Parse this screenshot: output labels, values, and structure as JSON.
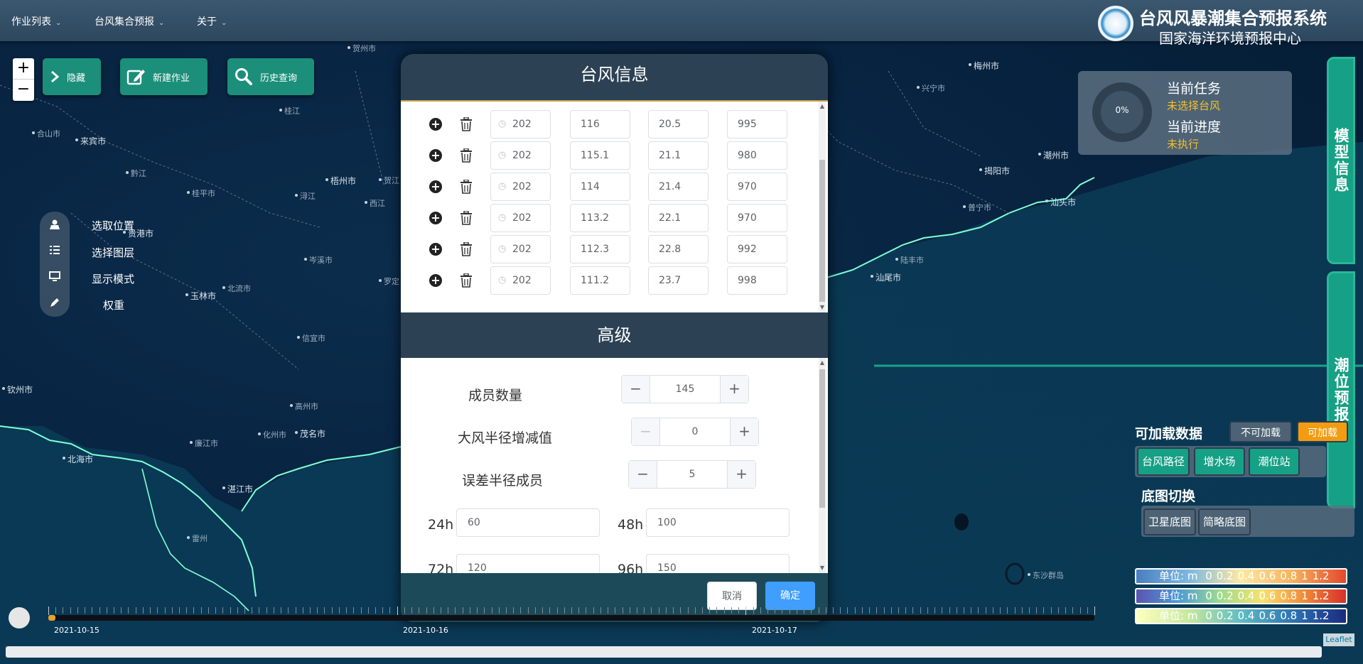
{
  "menu": {
    "items": [
      {
        "label": "作业列表"
      },
      {
        "label": "台风集合预报"
      },
      {
        "label": "关于"
      }
    ]
  },
  "header": {
    "title": "台风风暴潮集合预报系统",
    "subtitle": "国家海洋环境预报中心"
  },
  "zoom": {
    "in": "+",
    "out": "−"
  },
  "actions": {
    "hide": "隐藏",
    "new_job": "新建作业",
    "history": "历史查询"
  },
  "tools": [
    {
      "label": "选取位置",
      "icon": "map-marker-icon"
    },
    {
      "label": "选择图层",
      "icon": "list-icon"
    },
    {
      "label": "显示模式",
      "icon": "monitor-icon"
    },
    {
      "label": "权重",
      "icon": "pen-icon"
    }
  ],
  "map_labels": [
    {
      "name": "贺州市"
    },
    {
      "name": "合山市"
    },
    {
      "name": "来宾市"
    },
    {
      "name": "桂江"
    },
    {
      "name": "黔江"
    },
    {
      "name": "梧州市"
    },
    {
      "name": "贺江"
    },
    {
      "name": "西江"
    },
    {
      "name": "桂平市"
    },
    {
      "name": "浔江"
    },
    {
      "name": "贵港市"
    },
    {
      "name": "岑溪市"
    },
    {
      "name": "罗定"
    },
    {
      "name": "玉林市"
    },
    {
      "name": "北流市"
    },
    {
      "name": "信宜市"
    },
    {
      "name": "钦州市"
    },
    {
      "name": "高州市"
    },
    {
      "name": "化州市"
    },
    {
      "name": "茂名市"
    },
    {
      "name": "北海市"
    },
    {
      "name": "廉江市"
    },
    {
      "name": "湛江市"
    },
    {
      "name": "雷州"
    },
    {
      "name": "梅州市"
    },
    {
      "name": "兴宁市"
    },
    {
      "name": "揭阳市"
    },
    {
      "name": "潮州市"
    },
    {
      "name": "普宁市"
    },
    {
      "name": "汕头市"
    },
    {
      "name": "陆丰市"
    },
    {
      "name": "汕尾市"
    },
    {
      "name": "东沙群岛"
    }
  ],
  "modal": {
    "title": "台风信息",
    "track_rows": [
      {
        "time": "202",
        "lon": "116",
        "lat": "20.5",
        "pressure": "995"
      },
      {
        "time": "202",
        "lon": "115.1",
        "lat": "21.1",
        "pressure": "980"
      },
      {
        "time": "202",
        "lon": "114",
        "lat": "21.4",
        "pressure": "970"
      },
      {
        "time": "202",
        "lon": "113.2",
        "lat": "22.1",
        "pressure": "970"
      },
      {
        "time": "202",
        "lon": "112.3",
        "lat": "22.8",
        "pressure": "992"
      },
      {
        "time": "202",
        "lon": "111.2",
        "lat": "23.7",
        "pressure": "998"
      }
    ],
    "advanced_title": "高级",
    "members_label": "成员数量",
    "members_value": "145",
    "wind_radius_label": "大风半径增减值",
    "wind_radius_value": "0",
    "error_radius_label": "误差半径成员",
    "error_radius_value": "5",
    "hours": [
      {
        "label": "24h",
        "value": "60"
      },
      {
        "label": "48h",
        "value": "100"
      },
      {
        "label": "72h",
        "value": "120"
      },
      {
        "label": "96h",
        "value": "150"
      }
    ],
    "cancel": "取消",
    "confirm": "确定"
  },
  "timeline": {
    "dates": [
      "2021-10-15",
      "2021-10-16",
      "2021-10-17"
    ],
    "progress": 0.007
  },
  "task": {
    "progress_text": "0%",
    "current_task_label": "当前任务",
    "current_task_value": "未选择台风",
    "current_progress_label": "当前进度",
    "current_progress_value": "未执行"
  },
  "side_tabs": {
    "model_info": "模型信息",
    "tide_forecast": "潮位预报"
  },
  "layers": {
    "loadable_label": "可加载数据",
    "not_loadable": "不可加载",
    "loadable": "可加载",
    "buttons": [
      "台风路径",
      "增水场",
      "潮位站"
    ],
    "basemap_label": "底图切换",
    "basemaps": [
      "卫星底图",
      "简略底图"
    ]
  },
  "legends": [
    {
      "unit": "单位: m",
      "ticks": [
        "0",
        "0.2",
        "0.4",
        "0.6",
        "0.8",
        "1",
        "1.2"
      ]
    },
    {
      "unit": "单位: m",
      "ticks": [
        "0",
        "0.2",
        "0.4",
        "0.6",
        "0.8",
        "1",
        "1.2"
      ]
    },
    {
      "unit": "单位: m",
      "ticks": [
        "0",
        "0.2",
        "0.4",
        "0.6",
        "0.8",
        "1",
        "1.2"
      ]
    }
  ],
  "attribution": "Leaflet",
  "colors": {
    "accent_green": "#16a085",
    "warning_orange": "#f39c12",
    "confirm_blue": "#409eff",
    "status_yellow": "#f3c12e"
  }
}
